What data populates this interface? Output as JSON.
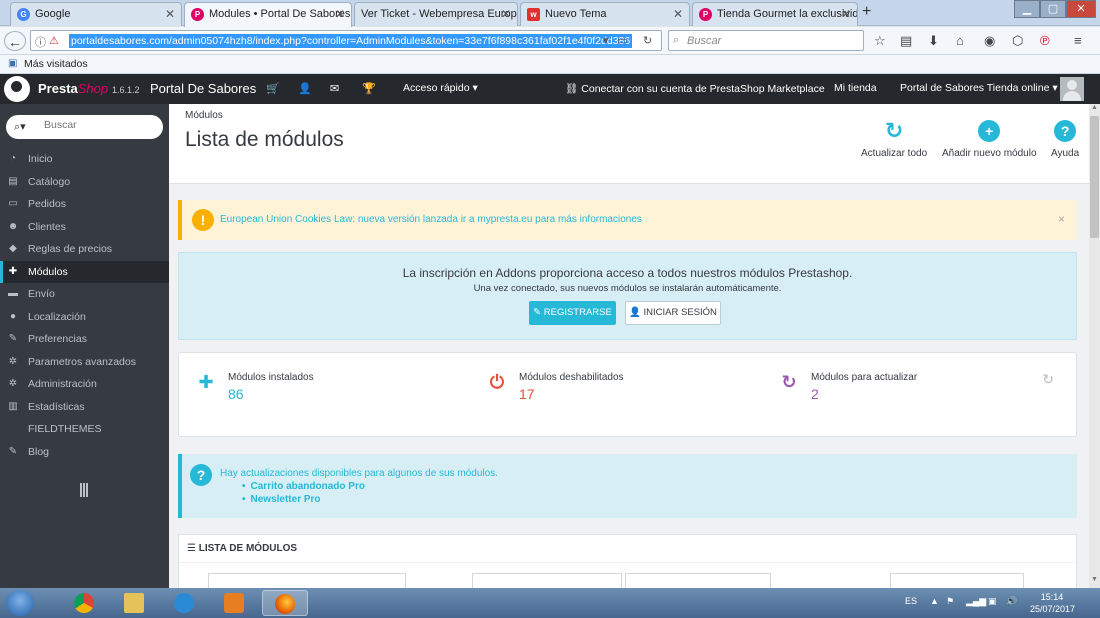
{
  "browser": {
    "tabs": [
      {
        "title": "Google",
        "favicon": "G",
        "color": "#4285f4"
      },
      {
        "title": "Modules • Portal De Sabores",
        "favicon": "P",
        "color": "#df0067",
        "active": true
      },
      {
        "title": "Ver Ticket - Webempresa Europa",
        "favicon": "",
        "color": ""
      },
      {
        "title": "Nuevo Tema",
        "favicon": "w",
        "color": "#e0312e"
      },
      {
        "title": "Tienda Gourmet la exclusivid",
        "favicon": "P",
        "color": "#df0067"
      }
    ],
    "url": "portaldesabores.com/admin05074hzh8/index.php?controller=AdminModules&token=33e7f6f898c361faf02f1e4f0f2dd386",
    "search_placeholder": "Buscar",
    "bookmark_label": "Más visitados"
  },
  "header": {
    "brand_presta": "Presta",
    "brand_shop": "Shop",
    "version": "1.6.1.2",
    "store_name": "Portal De Sabores",
    "quick_access": "Acceso rápido ▾",
    "marketplace": "Conectar con su cuenta de PrestaShop Marketplace",
    "my_store": "Mi tienda",
    "store_online": "Portal de Sabores Tienda online ▾"
  },
  "sidebar": {
    "search_placeholder": "Buscar",
    "items": [
      {
        "label": "Inicio",
        "icon": "dashboard-icon",
        "glyph": "◔"
      },
      {
        "label": "Catálogo",
        "icon": "book-icon",
        "glyph": "▤"
      },
      {
        "label": "Pedidos",
        "icon": "credit-card-icon",
        "glyph": "▭"
      },
      {
        "label": "Clientes",
        "icon": "group-icon",
        "glyph": "☻"
      },
      {
        "label": "Reglas de precios",
        "icon": "tags-icon",
        "glyph": "◆"
      },
      {
        "label": "Módulos",
        "icon": "puzzle-icon",
        "glyph": "✚",
        "active": true
      },
      {
        "label": "Envío",
        "icon": "truck-icon",
        "glyph": "▬"
      },
      {
        "label": "Localización",
        "icon": "globe-icon",
        "glyph": "●"
      },
      {
        "label": "Preferencias",
        "icon": "wrench-icon",
        "glyph": "✎"
      },
      {
        "label": "Parametros avanzados",
        "icon": "cogs-icon",
        "glyph": "✲"
      },
      {
        "label": "Administración",
        "icon": "cog-icon",
        "glyph": "✲"
      },
      {
        "label": "Estadísticas",
        "icon": "bar-chart-icon",
        "glyph": "▥"
      },
      {
        "label": "FIELDTHEMES",
        "icon": "",
        "glyph": ""
      },
      {
        "label": "Blog",
        "icon": "pencil-icon",
        "glyph": "✎"
      }
    ]
  },
  "page": {
    "breadcrumb": "Módulos",
    "title": "Lista de módulos",
    "toolbar": {
      "update_all": "Actualizar todo",
      "add_module": "Añadir nuevo módulo",
      "help": "Ayuda"
    }
  },
  "alerts": {
    "cookies": "European Union Cookies Law: nueva versión lanzada ir a mypresta.eu para más informaciones",
    "addons_title": "La inscripción en Addons proporciona acceso a todos nuestros módulos Prestashop.",
    "addons_subtitle": "Una vez conectado, sus nuevos módulos se instalarán automáticamente.",
    "register": "REGISTRARSE",
    "login": "INICIAR SESIÓN"
  },
  "stats": {
    "installed_label": "Módulos instalados",
    "installed_value": "86",
    "disabled_label": "Módulos deshabilitados",
    "disabled_value": "17",
    "to_update_label": "Módulos para actualizar",
    "to_update_value": "2",
    "colors": {
      "installed": "#25b9d7",
      "disabled": "#e84e3d",
      "update": "#9b59b6"
    }
  },
  "updates": {
    "text": "Hay actualizaciones disponibles para algunos de sus módulos.",
    "modules": [
      "Carrito abandonado Pro",
      "Newsletter Pro"
    ]
  },
  "module_list": {
    "heading": "LISTA DE MÓDULOS"
  },
  "taskbar": {
    "language": "ES",
    "time": "15:14",
    "date": "25/07/2017"
  }
}
